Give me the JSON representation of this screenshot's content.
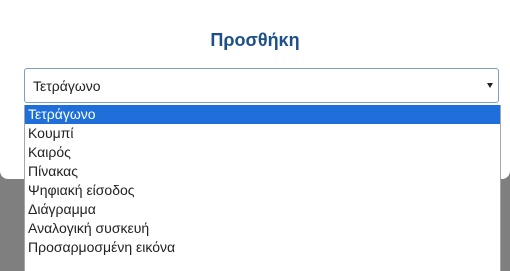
{
  "dialog": {
    "title": "Προσθήκη"
  },
  "select": {
    "selected_value": "Τετράγωνο",
    "arrow_icon": "caret-down-icon",
    "options": [
      "Τετράγωνο",
      "Κουμπί",
      "Καιρός",
      "Πίνακας",
      "Ψηφιακή είσοδος",
      "Διάγραμμα",
      "Αναλογική συσκευή",
      "Προσαρμοσμένη εικόνα"
    ],
    "highlighted_index": 0
  },
  "colors": {
    "title": "#1d4f8a",
    "highlight": "#1e6fd9",
    "backdrop": "#7f7f7f"
  }
}
